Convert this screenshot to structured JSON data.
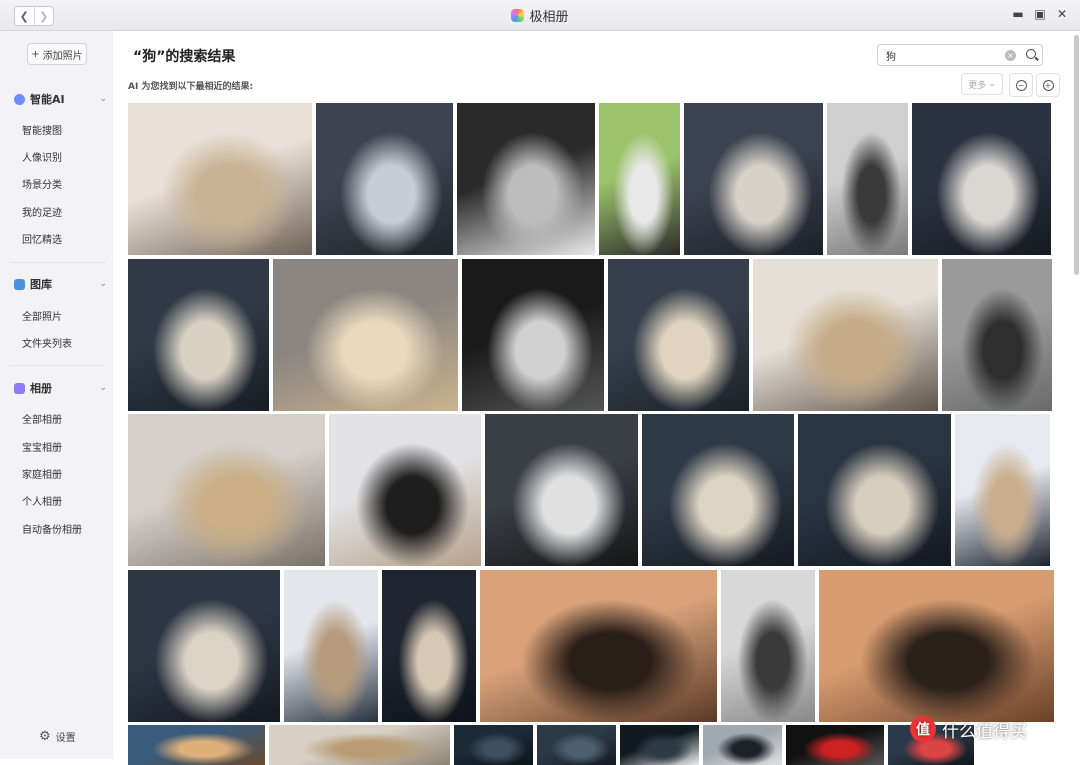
{
  "titlebar": {
    "app_title": "极相册"
  },
  "sidebar": {
    "add_button": "添加照片",
    "sections": [
      {
        "title": "智能AI",
        "icon": "ai-icon",
        "color": "#6c8cff",
        "items": [
          "智能搜图",
          "人像识别",
          "场景分类",
          "我的足迹",
          "回忆精选"
        ]
      },
      {
        "title": "图库",
        "icon": "gallery-icon",
        "color": "#4a90e2",
        "items": [
          "全部照片",
          "文件夹列表"
        ]
      },
      {
        "title": "相册",
        "icon": "album-icon",
        "color": "#8b7cf6",
        "items": [
          "全部相册",
          "宝宝相册",
          "家庭相册",
          "个人相册",
          "自动备份相册"
        ]
      }
    ],
    "settings": "设置"
  },
  "main": {
    "title": "“狗”的搜索结果",
    "subtitle": "AI 为您找到以下最相近的结果:",
    "search_value": "狗",
    "more_label": "更多"
  },
  "watermark": {
    "badge": "值",
    "text": "什么值得买"
  },
  "photos": [
    {
      "row": 0,
      "c": [
        "#e9e1d8",
        "#c9b293",
        "#6f6256"
      ]
    },
    {
      "row": 0,
      "c": [
        "#3d4450",
        "#c7cdd5",
        "#1f242b"
      ]
    },
    {
      "row": 0,
      "c": [
        "#2a2a2a",
        "#bdbdbd",
        "#eaeaea"
      ]
    },
    {
      "row": 0,
      "c": [
        "#9bc36b",
        "#e8e8e8",
        "#2b2b2b"
      ]
    },
    {
      "row": 0,
      "c": [
        "#3b4350",
        "#d7d2c8",
        "#1c2028"
      ]
    },
    {
      "row": 0,
      "c": [
        "#cfcfcf",
        "#3a3a3a",
        "#7a7a7a"
      ]
    },
    {
      "row": 0,
      "c": [
        "#2b3341",
        "#dad7d2",
        "#151a22"
      ]
    },
    {
      "row": 1,
      "c": [
        "#2f3a46",
        "#d9d2c4",
        "#171d25"
      ]
    },
    {
      "row": 1,
      "c": [
        "#8a8580",
        "#e9d9bd",
        "#cbb38e"
      ]
    },
    {
      "row": 1,
      "c": [
        "#1a1a1a",
        "#d0d0d0",
        "#555"
      ]
    },
    {
      "row": 1,
      "c": [
        "#36404c",
        "#e0d4c0",
        "#1b2129"
      ]
    },
    {
      "row": 1,
      "c": [
        "#e5dfd6",
        "#c5ab87",
        "#5e544a"
      ]
    },
    {
      "row": 1,
      "c": [
        "#9a9a9a",
        "#2e2e2e",
        "#6a6a6a"
      ]
    },
    {
      "row": 2,
      "c": [
        "#d4cfc9",
        "#c9ae86",
        "#7a7068"
      ]
    },
    {
      "row": 2,
      "c": [
        "#e2e2e4",
        "#1e1e1e",
        "#b6a28a"
      ]
    },
    {
      "row": 2,
      "c": [
        "#3a3f46",
        "#e0e0e0",
        "#161616"
      ]
    },
    {
      "row": 2,
      "c": [
        "#2f3a47",
        "#ddd3c3",
        "#141a22"
      ]
    },
    {
      "row": 2,
      "c": [
        "#2a3542",
        "#d7cdbd",
        "#121820"
      ]
    },
    {
      "row": 2,
      "c": [
        "#e6e9ee",
        "#c9ae8e",
        "#1d2430"
      ]
    },
    {
      "row": 3,
      "c": [
        "#2d3744",
        "#dcd3c6",
        "#131922"
      ]
    },
    {
      "row": 3,
      "c": [
        "#e3e7ec",
        "#b59a7c",
        "#283240"
      ]
    },
    {
      "row": 3,
      "c": [
        "#1f2631",
        "#d6c8b3",
        "#0e131a"
      ]
    },
    {
      "row": 3,
      "c": [
        "#d9a27a",
        "#2a1e18",
        "#5a3a26"
      ]
    },
    {
      "row": 3,
      "c": [
        "#d8d8d8",
        "#3a3a3a",
        "#888"
      ]
    },
    {
      "row": 3,
      "c": [
        "#d79c70",
        "#2b201a",
        "#6a4128"
      ]
    },
    {
      "row": 4,
      "c": [
        "#3a5b7a",
        "#e0b07a",
        "#6a4a2e"
      ]
    },
    {
      "row": 4,
      "c": [
        "#d8d0c4",
        "#b99c74",
        "#8c8276"
      ]
    },
    {
      "row": 4,
      "c": [
        "#1c2a36",
        "#3d5060",
        "#0d141c"
      ]
    },
    {
      "row": 4,
      "c": [
        "#2c3a48",
        "#4d6070",
        "#121a22"
      ]
    },
    {
      "row": 4,
      "c": [
        "#0f1a22",
        "#2b3a44",
        "#eee"
      ]
    },
    {
      "row": 4,
      "c": [
        "#a0a8b0",
        "#1b2228",
        "#e0e0e0"
      ]
    },
    {
      "row": 4,
      "c": [
        "#111",
        "#c22",
        "#555"
      ]
    },
    {
      "row": 4,
      "c": [
        "#2a3a48",
        "#dd4444",
        "#0f161e"
      ]
    }
  ]
}
